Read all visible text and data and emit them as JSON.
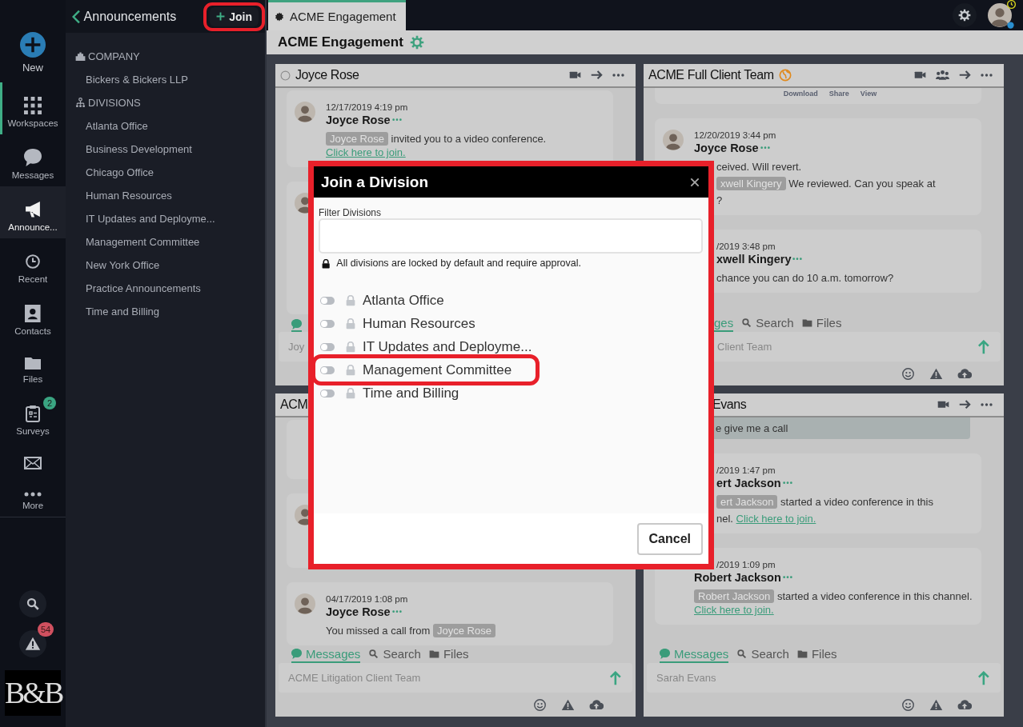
{
  "rail": {
    "items": [
      {
        "label": "New",
        "selected": false,
        "active": false
      },
      {
        "label": "Workspaces",
        "selected": false,
        "active": true
      },
      {
        "label": "Messages",
        "selected": false,
        "active": false
      },
      {
        "label": "Announce...",
        "selected": true,
        "active": false
      },
      {
        "label": "Recent",
        "selected": false,
        "active": false
      },
      {
        "label": "Contacts",
        "selected": false,
        "active": false
      },
      {
        "label": "Files",
        "selected": false,
        "active": false
      },
      {
        "label": "Surveys",
        "selected": false,
        "active": false,
        "badge": "2"
      },
      {
        "selected": false,
        "active": false
      },
      {
        "label": "More",
        "selected": false,
        "active": false
      }
    ],
    "alerts_count": "54",
    "logo": "B&B"
  },
  "sidebar": {
    "title": "Announcements",
    "join": {
      "label": "Join",
      "highlighted": true
    },
    "sections": [
      {
        "heading": "COMPANY",
        "items": [
          "Bickers & Bickers LLP"
        ]
      },
      {
        "heading": "DIVISIONS",
        "items": [
          "Atlanta Office",
          "Business Development",
          "Chicago Office",
          "Human Resources",
          "IT Updates and Deployme...",
          "Management Committee",
          "New York Office",
          "Practice Announcements",
          "Time and Billing"
        ]
      }
    ]
  },
  "tabs": [
    {
      "label": "ACME Engagement",
      "selected": true
    }
  ],
  "workspace": {
    "title": "ACME Engagement"
  },
  "panels": [
    {
      "title": "Joyce Rose",
      "status": {
        "online": false
      },
      "actions": true,
      "items": [
        {
          "kind": "message",
          "avatar": true,
          "time": {
            "text": "12/17/2019 4:19 pm"
          },
          "author": {
            "text": "Joyce Rose"
          },
          "lines": [
            {
              "parts": [
                {
                  "kind": "chip",
                  "text": "Joyce Rose"
                },
                {
                  "kind": "text",
                  "text": "invited you to a video conference."
                },
                {
                  "kind": "link",
                  "text": "Click here to join."
                }
              ]
            }
          ]
        },
        {
          "kind": "covered",
          "avatar": true
        }
      ],
      "tabs": [
        {
          "selected": true
        }
      ],
      "input": {
        "placeholder": "Joy"
      }
    },
    {
      "title": "ACME Full Client Team",
      "actions": true,
      "team": true,
      "external": true,
      "items": [
        {
          "kind": "attachment",
          "actions": [
            "Download",
            "Share",
            "View"
          ]
        },
        {
          "kind": "message",
          "avatar": true,
          "time": {
            "text": "12/20/2019 3:44 pm"
          },
          "author": {
            "text": "Joyce Rose"
          },
          "lines": [
            {
              "cut": true,
              "parts": [
                {
                  "kind": "text",
                  "text": "ceived. Will revert."
                }
              ]
            },
            {
              "cut": true,
              "parts": [
                {
                  "kind": "chip",
                  "text": "xwell Kingery"
                },
                {
                  "kind": "text",
                  "text": "We reviewed. Can you speak at"
                }
              ]
            },
            {
              "cut": true,
              "parts": [
                {
                  "kind": "text",
                  "text": "?"
                }
              ]
            }
          ]
        },
        {
          "kind": "message",
          "time": {
            "text": "/2019 3:48 pm",
            "cut": true
          },
          "author": {
            "text": "xwell Kingery",
            "cut": true
          },
          "lines": [
            {
              "cut": true,
              "parts": [
                {
                  "kind": "text",
                  "text": "chance you can do 10 a.m. tomorrow?"
                }
              ]
            }
          ]
        }
      ],
      "tabs": [
        {
          "label": "ges",
          "cut": true,
          "selected": true
        },
        {
          "label": "Search",
          "selected": false
        },
        {
          "label": "Files",
          "selected": false
        }
      ],
      "input": {
        "placeholder": "Client Team",
        "cut": true
      },
      "tools": true
    },
    {
      "title": "ACM",
      "items": [
        {
          "kind": "covered"
        },
        {
          "kind": "covered",
          "avatar": true
        },
        {
          "kind": "message",
          "avatar": true,
          "time": {
            "text": "04/17/2019 1:08 pm"
          },
          "author": {
            "text": "Joyce Rose"
          },
          "lines": [
            {
              "parts": [
                {
                  "kind": "text",
                  "text": "You missed a call from"
                },
                {
                  "kind": "chip",
                  "text": "Joyce Rose"
                }
              ]
            }
          ]
        }
      ],
      "tabs": [
        {
          "label": "Messages",
          "selected": true
        },
        {
          "label": "Search",
          "selected": false
        },
        {
          "label": "Files",
          "selected": false
        }
      ],
      "input": {
        "placeholder": "ACME Litigation Client Team"
      },
      "tools": true
    },
    {
      "title": "Evans",
      "title_cut": true,
      "actions": true,
      "items": [
        {
          "kind": "bubble",
          "text": "e give me a call",
          "cut": true
        },
        {
          "kind": "message",
          "time": {
            "text": "/2019 1:47 pm",
            "cut": true
          },
          "author": {
            "text": "ert Jackson",
            "cut": true
          },
          "lines": [
            {
              "cut": true,
              "parts": [
                {
                  "kind": "chip",
                  "text": "ert Jackson"
                },
                {
                  "kind": "text",
                  "text": "started a video conference in this"
                }
              ]
            },
            {
              "cut": true,
              "parts": [
                {
                  "kind": "text",
                  "text": "nel."
                },
                {
                  "kind": "link",
                  "text": "Click here to join."
                }
              ]
            }
          ]
        },
        {
          "kind": "message",
          "time": {
            "text": "/2019 1:09 pm",
            "cut": true
          },
          "author": {
            "text": "Robert Jackson"
          },
          "lines": [
            {
              "parts": [
                {
                  "kind": "chip",
                  "text": "Robert Jackson"
                },
                {
                  "kind": "text",
                  "text": "started a video conference in this channel."
                },
                {
                  "kind": "link",
                  "text": "Click here to join."
                }
              ]
            }
          ]
        }
      ],
      "tabs": [
        {
          "label": "Messages",
          "selected": true
        },
        {
          "label": "Search",
          "selected": false
        },
        {
          "label": "Files",
          "selected": false
        }
      ],
      "input": {
        "placeholder": "Sarah Evans"
      },
      "tools": true
    }
  ],
  "modal": {
    "title": "Join a Division",
    "highlighted": true,
    "filter": {
      "label": "Filter Divisions"
    },
    "note": "All divisions are locked by default and require approval.",
    "divisions": [
      {
        "name": "Atlanta Office",
        "on": false
      },
      {
        "name": "Human Resources",
        "on": false
      },
      {
        "name": "IT Updates and Deployme...",
        "on": false
      },
      {
        "name": "Management Committee",
        "on": false,
        "highlighted": true
      },
      {
        "name": "Time and Billing",
        "on": false
      }
    ],
    "cancel": "Cancel"
  }
}
